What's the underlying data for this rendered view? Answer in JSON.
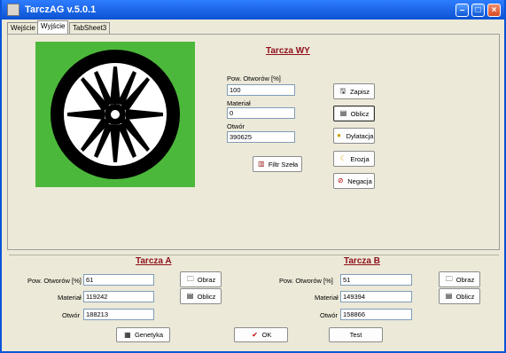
{
  "window": {
    "title": "TarczAG v.5.0.1"
  },
  "tabs": [
    {
      "label": "Wejście"
    },
    {
      "label": "Wyjście"
    },
    {
      "label": "TabSheet3"
    }
  ],
  "output": {
    "title": "Tarcza WY",
    "pow_otworow_label": "Pow. Otworów [%]",
    "pow_otworow_value": "100",
    "material_label": "Materiał",
    "material_value": "0",
    "otwor_label": "Otwór",
    "otwor_value": "390625",
    "buttons": {
      "zapisz": "Zapisz",
      "oblicz": "Oblicz",
      "dylatacja": "Dylatacja",
      "erozja": "Erozja",
      "negacja": "Negacja",
      "filtr": "Filtr Szeła"
    }
  },
  "tarcza_a": {
    "title": "Tarcza A",
    "pow_otworow_label": "Pow. Otworów [%]",
    "pow_otworow_value": "61",
    "material_label": "Materiał",
    "material_value": "119242",
    "otwor_label": "Otwór",
    "otwor_value": "188213",
    "obraz_label": "Obraz",
    "oblicz_label": "Oblicz"
  },
  "tarcza_b": {
    "title": "Tarcza B",
    "pow_otworow_label": "Pow. Otworów [%]",
    "pow_otworow_value": "51",
    "material_label": "Materiał",
    "material_value": "149394",
    "otwor_label": "Otwór",
    "otwor_value": "158866",
    "obraz_label": "Obraz",
    "oblicz_label": "Oblicz"
  },
  "footer": {
    "genetyka": "Genetyka",
    "ok": "OK",
    "test": "Test"
  },
  "icons": {
    "app": "app-icon",
    "save": "save-icon",
    "calculator": "calculator-icon",
    "bulb": "light-bulb-icon",
    "erosion": "erosion-icon",
    "negation": "negation-icon",
    "filter": "filter-icon",
    "folder": "folder-icon",
    "check": "check-icon",
    "genetics": "genetics-icon"
  },
  "colors": {
    "titlebar": "#0b52d1",
    "section_title": "#8f0f1b",
    "disc_background": "#4cb83b"
  }
}
